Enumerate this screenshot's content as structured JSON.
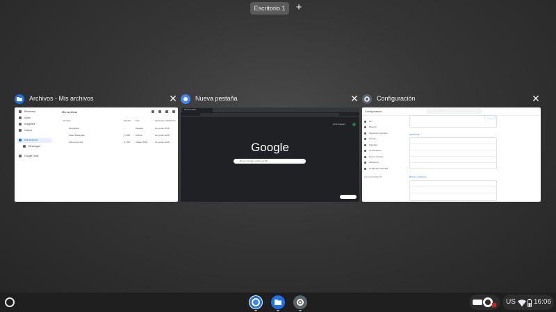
{
  "desk_bar": {
    "desk_label": "Escritorio 1",
    "add_label": "+"
  },
  "windows": [
    {
      "title": "Archivos - Mis archivos",
      "icon": "files-icon",
      "color": "#1a73e8",
      "preview": {
        "title": "Mis archivos",
        "sidebar": [
          "Recientes",
          "Audio",
          "Imágenes",
          "Vídeos",
          "Mis archivos",
          "Descargas",
          "Google Drive"
        ],
        "columns": [
          "Nombre",
          "Tamaño",
          "Tipo",
          "Fecha de modificación"
        ],
        "rows": [
          [
            "Descargas",
            "--",
            "Carpeta",
            "Hoy a las 15:45"
          ],
          [
            "Cloud Ready.app",
            "1,2 KB",
            "Archivo",
            "Hoy a las 12:09"
          ],
          [
            "frame-icon.png",
            "3,7 KB",
            "Imagen PNG",
            "Hoy a las 12:09"
          ]
        ]
      }
    },
    {
      "title": "Nueva pestaña",
      "icon": "chrome-icon",
      "color": "#4285f4",
      "preview": {
        "tab": "Nueva pestaña",
        "logo": "Google",
        "search_placeholder": "Busca en Google o escribe una URL",
        "links": [
          "Gmail",
          "Imágenes"
        ]
      }
    },
    {
      "title": "Configuración",
      "icon": "settings-icon",
      "color": "#5f6368",
      "preview": {
        "title": "Configuración",
        "nav": [
          "Red",
          "Bluetooth",
          "Dispositivos conectados",
          "Personas",
          "Dispositivo",
          "Personalización",
          "Buscar y Asistente",
          "Aplicaciones",
          "Configuración avanzada",
          "Acerca de Chrome OS"
        ],
        "section_appearance": "Apariencia",
        "section_search": "Buscar y Asistente"
      }
    }
  ],
  "shelf": {
    "apps": [
      "chrome-icon",
      "files-icon",
      "settings-icon"
    ],
    "tray": {
      "lang": "US",
      "time": "16:06"
    }
  }
}
